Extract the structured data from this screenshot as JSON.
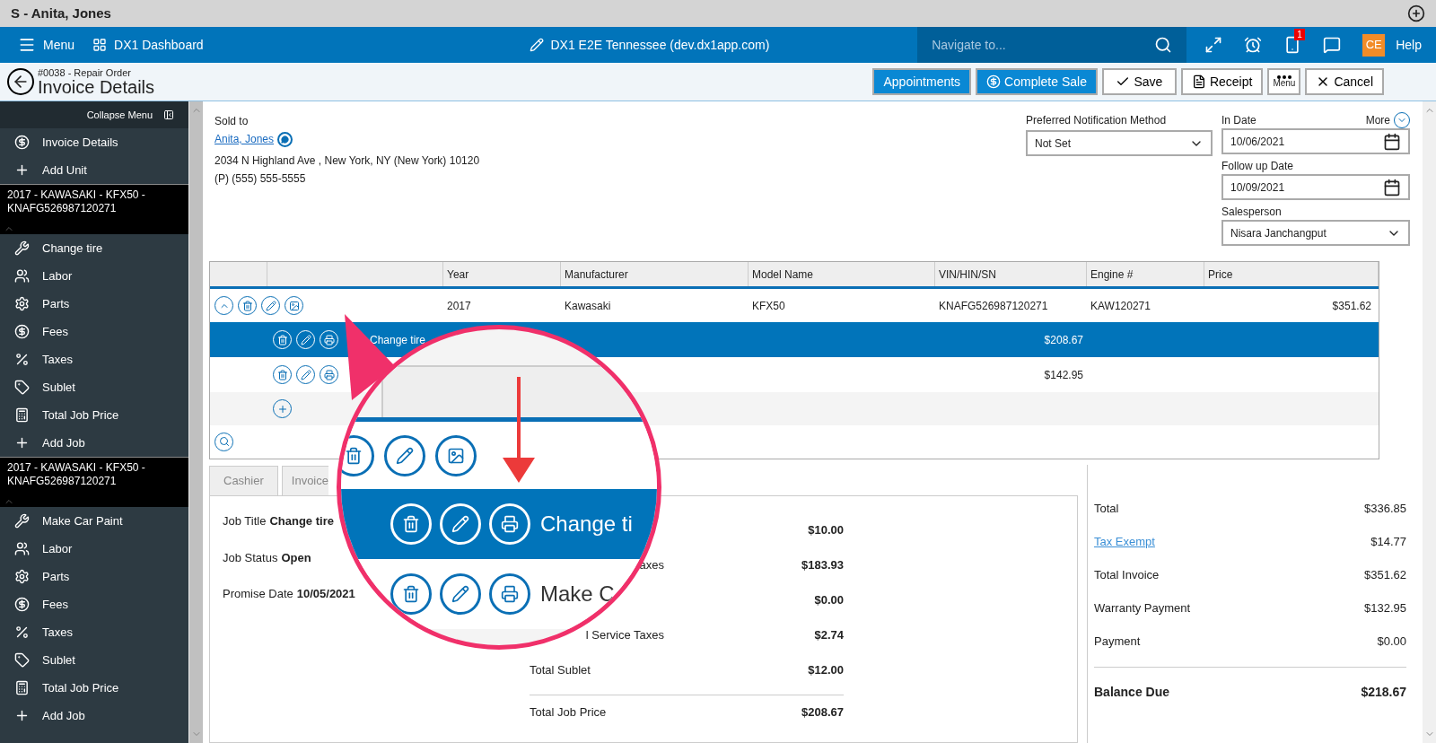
{
  "title_bar": {
    "title": "S - Anita, Jones"
  },
  "nav": {
    "menu": "Menu",
    "dashboard": "DX1 Dashboard",
    "site": "DX1 E2E Tennessee (dev.dx1app.com)",
    "search": {
      "placeholder": "Navigate to..."
    },
    "notification_badge": "1",
    "user_initials": "CE",
    "help": "Help"
  },
  "header": {
    "subtitle": "#0038 - Repair Order",
    "title": "Invoice Details",
    "buttons": [
      {
        "kind": "primary",
        "label": "Appointments"
      },
      {
        "kind": "sale",
        "label": "Complete Sale"
      },
      {
        "kind": "save",
        "label": "Save"
      },
      {
        "kind": "receipt",
        "label": "Receipt"
      },
      {
        "kind": "menu",
        "label": "Menu"
      },
      {
        "kind": "cancel",
        "label": "Cancel"
      }
    ]
  },
  "sidebar": {
    "collapse": "Collapse Menu",
    "groups": [
      {
        "items": [
          {
            "kind": "dollar",
            "label": "Invoice Details"
          },
          {
            "kind": "add",
            "label": "Add Unit"
          }
        ]
      },
      {
        "unit": "2017 - KAWASAKI - KFX50 - KNAFG526987120271",
        "items": [
          {
            "kind": "wrench",
            "label": "Change tire"
          },
          {
            "kind": "labor",
            "label": "Labor"
          },
          {
            "kind": "gear",
            "label": "Parts"
          },
          {
            "kind": "dollar",
            "label": "Fees"
          },
          {
            "kind": "tax",
            "label": "Taxes"
          },
          {
            "kind": "tag",
            "label": "Sublet"
          },
          {
            "kind": "calc",
            "label": "Total Job Price"
          },
          {
            "kind": "add",
            "label": "Add Job"
          }
        ]
      },
      {
        "unit": "2017 - KAWASAKI - KFX50 - KNAFG526987120271",
        "items": [
          {
            "kind": "wrench",
            "label": "Make Car Paint"
          },
          {
            "kind": "labor",
            "label": "Labor"
          },
          {
            "kind": "gear",
            "label": "Parts"
          },
          {
            "kind": "dollar",
            "label": "Fees"
          },
          {
            "kind": "tax",
            "label": "Taxes"
          },
          {
            "kind": "tag",
            "label": "Sublet"
          },
          {
            "kind": "calc",
            "label": "Total Job Price"
          },
          {
            "kind": "add",
            "label": "Add Job"
          }
        ]
      }
    ]
  },
  "customer": {
    "label": "Sold to",
    "name": "Anita, Jones",
    "address": "2034 N Highland Ave , New York, NY (New York) 10120",
    "phone": "(P) (555) 555-5555"
  },
  "form": {
    "notification": {
      "label": "Preferred Notification Method",
      "value": "Not Set"
    },
    "in_date": {
      "label": "In Date",
      "value": "10/06/2021"
    },
    "more": "More",
    "follow_up": {
      "label": "Follow up Date",
      "value": "10/09/2021"
    },
    "salesperson": {
      "label": "Salesperson",
      "value": "Nisara Janchangput"
    }
  },
  "table": {
    "columns": [
      "Year",
      "Manufacturer",
      "Model Name",
      "VIN/HIN/SN",
      "Engine #",
      "Price"
    ],
    "unit": {
      "year": "2017",
      "manufacturer": "Kawasaki",
      "model": "KFX50",
      "vin": "KNAFG526987120271",
      "engine": "KAW120271",
      "price": "$351.62"
    },
    "jobs": [
      {
        "selected": true,
        "label": "Change tire",
        "price": "$208.67"
      },
      {
        "selected": false,
        "price": "$142.95"
      }
    ]
  },
  "tabs": [
    {
      "label": "Cashier",
      "selected": false
    },
    {
      "label": "Invoice",
      "selected": false
    }
  ],
  "job_info": [
    {
      "label": "Job Title",
      "value": "Change tire"
    },
    {
      "label": "Job Status",
      "value": "Open"
    },
    {
      "label": "Promise Date",
      "value": "10/05/2021"
    }
  ],
  "job_totals": [
    {
      "kind": "row",
      "value": "$10.00"
    },
    {
      "kind": "row",
      "label": "axes",
      "clipped": true,
      "value": "$183.93"
    },
    {
      "kind": "row",
      "value": "$0.00"
    },
    {
      "kind": "row",
      "label": "l Service Taxes",
      "clipped": true,
      "value": "$2.74"
    },
    {
      "kind": "row",
      "label": "Total Sublet",
      "clipped": false,
      "value": "$12.00"
    },
    {
      "kind": "total",
      "label": "Total Job Price",
      "clipped": false,
      "value": "$208.67"
    }
  ],
  "summary": [
    {
      "kind": "row",
      "label": "Total",
      "value": "$336.85"
    },
    {
      "kind": "link",
      "label": "Tax Exempt",
      "value": "$14.77"
    },
    {
      "kind": "row",
      "label": "Total Invoice",
      "value": "$351.62"
    },
    {
      "kind": "row",
      "label": "Warranty Payment",
      "value": "$132.95"
    },
    {
      "kind": "row",
      "label": "Payment",
      "value": "$0.00"
    },
    {
      "kind": "total",
      "label": "Balance Due",
      "value": "$218.67"
    }
  ],
  "magnifier": {
    "rows": [
      {
        "kind": "unit"
      },
      {
        "kind": "job",
        "selected": true,
        "label": "Change ti"
      },
      {
        "kind": "job",
        "selected": false,
        "label": "Make C"
      }
    ]
  }
}
